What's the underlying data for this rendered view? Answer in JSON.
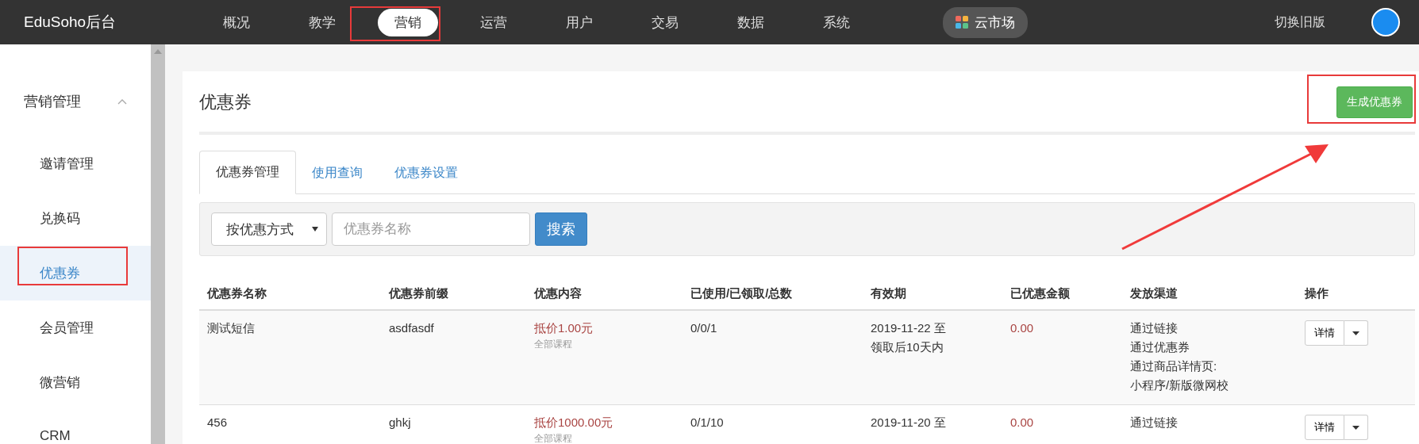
{
  "brand": "EduSoho后台",
  "nav": [
    {
      "label": "概况",
      "selected": false
    },
    {
      "label": "教学",
      "selected": false
    },
    {
      "label": "营销",
      "selected": true
    },
    {
      "label": "运营",
      "selected": false
    },
    {
      "label": "用户",
      "selected": false
    },
    {
      "label": "交易",
      "selected": false
    },
    {
      "label": "数据",
      "selected": false
    },
    {
      "label": "系统",
      "selected": false
    }
  ],
  "marketplace": "云市场",
  "switch_link": "切换旧版",
  "sidebar": {
    "group": {
      "label": "营销管理",
      "expanded": true
    },
    "items": [
      {
        "label": "邀请管理",
        "selected": false
      },
      {
        "label": "兑换码",
        "selected": false
      },
      {
        "label": "优惠券",
        "selected": true
      },
      {
        "label": "会员管理",
        "selected": false
      },
      {
        "label": "微营销",
        "selected": false
      },
      {
        "label": "CRM",
        "selected": false
      }
    ]
  },
  "page": {
    "title": "优惠券",
    "create_button": "生成优惠券"
  },
  "tabs": [
    {
      "label": "优惠券管理",
      "selected": true
    },
    {
      "label": "使用查询",
      "selected": false
    },
    {
      "label": "优惠券设置",
      "selected": false
    }
  ],
  "filter": {
    "select": "按优惠方式",
    "placeholder": "优惠券名称",
    "search_button": "搜索"
  },
  "table": {
    "columns": [
      "优惠券名称",
      "优惠券前缀",
      "优惠内容",
      "已使用/已领取/总数",
      "有效期",
      "已优惠金额",
      "发放渠道",
      "操作"
    ],
    "rows": [
      {
        "name": "测试短信",
        "prefix": "asdfasdf",
        "content": "抵价1.00元",
        "scope": "全部课程",
        "counts": "0/0/1",
        "validity": [
          "2019-11-22 至",
          "领取后10天内"
        ],
        "amount": "0.00",
        "channels": [
          "通过链接",
          "通过优惠券",
          "通过商品详情页:",
          "小程序/新版微网校"
        ],
        "action": "详情"
      },
      {
        "name": "456",
        "prefix": "ghkj",
        "content": "抵价1000.00元",
        "scope": "全部课程",
        "counts": "0/1/10",
        "validity": [
          "2019-11-20 至"
        ],
        "amount": "0.00",
        "channels": [
          "通过链接"
        ],
        "action": "详情"
      }
    ]
  }
}
